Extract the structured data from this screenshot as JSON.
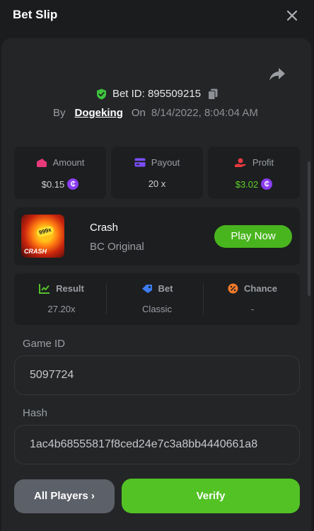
{
  "header": {
    "title": "Bet Slip"
  },
  "bet": {
    "id_label": "Bet ID:",
    "id_value": "895509215",
    "by_label": "By",
    "user": "Dogeking",
    "on_label": "On",
    "datetime": "8/14/2022, 8:04:04 AM"
  },
  "stats": {
    "amount_label": "Amount",
    "amount_value": "$0.15",
    "payout_label": "Payout",
    "payout_value": "20 x",
    "profit_label": "Profit",
    "profit_value": "$3.02"
  },
  "game": {
    "name": "Crash",
    "subtitle": "BC Original",
    "play_label": "Play Now",
    "thumb_badge": "999x",
    "thumb_text": "CRASH"
  },
  "result": {
    "result_label": "Result",
    "result_value": "27.20x",
    "bet_label": "Bet",
    "bet_value": "Classic",
    "chance_label": "Chance",
    "chance_value": "-"
  },
  "fields": {
    "game_id_label": "Game ID",
    "game_id_value": "5097724",
    "hash_label": "Hash",
    "hash_value": "1ac4b68555817f8ced24e7c3a8bb4440661a8"
  },
  "actions": {
    "all_players_label": "All Players ›",
    "verify_label": "Verify"
  },
  "colors": {
    "background": "#1b1c1e",
    "panel": "#232527",
    "card": "#1c1e20",
    "accent_green": "#52c224",
    "coin_purple": "#8a3df0"
  }
}
